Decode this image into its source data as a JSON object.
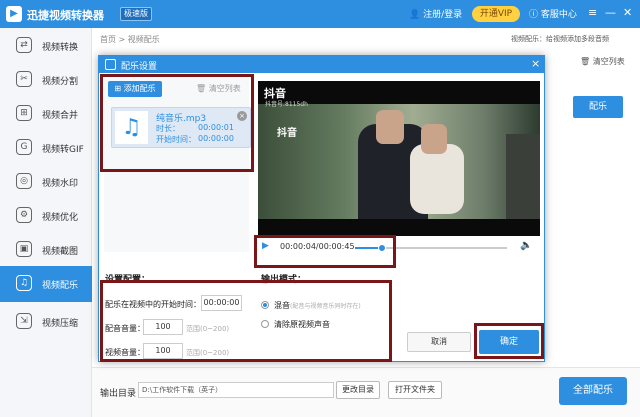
{
  "app": {
    "title": "迅捷视频转换器",
    "version": "极速版",
    "user": "注册/登录",
    "vip": "开通VIP",
    "service": "客服中心",
    "controls": {
      "menu": "≡",
      "minimize": "—",
      "close": "✕"
    }
  },
  "sidebar": {
    "items": [
      {
        "label": "视频转换",
        "icon": "⇄"
      },
      {
        "label": "视频分割",
        "icon": "✂"
      },
      {
        "label": "视频合并",
        "icon": "⊞"
      },
      {
        "label": "视频转GIF",
        "icon": "G"
      },
      {
        "label": "视频水印",
        "icon": "◎"
      },
      {
        "label": "视频优化",
        "icon": "⚙"
      },
      {
        "label": "视频截图",
        "icon": "▣"
      },
      {
        "label": "视频配乐",
        "icon": "♫",
        "active": true
      },
      {
        "label": "视频压缩",
        "icon": "⇲"
      }
    ]
  },
  "main": {
    "breadcrumb": "首页 > 视频配乐",
    "hint": "视频配乐：给视频添加多段音频",
    "clear_list": "清空列表",
    "pei_label": "配乐"
  },
  "output": {
    "label": "输出目录",
    "path": "D:\\工作软件下载（英子）",
    "change": "更改目录",
    "open": "打开文件夹",
    "all_label": "全部配乐"
  },
  "dialog": {
    "title": "配乐设置",
    "close": "×",
    "add_music": "添加配乐",
    "clear_list": "清空列表",
    "music": {
      "name": "纯音乐.mp3",
      "duration_label": "时长：",
      "duration": "00:00:01",
      "start_label": "开始时间：",
      "start": "00:00:00"
    },
    "video": {
      "wm1": "抖音",
      "wm2": "抖音号:8115dh",
      "wm3": "抖音"
    },
    "player": {
      "time": "00:00:04/00:00:45",
      "progress": 0.18
    },
    "settings": {
      "title": "设置配置：",
      "start_label": "配乐在视频中的开始时间：",
      "start_value": "00:00:00",
      "music_vol_label": "配音音量：",
      "music_vol": "100",
      "music_range": "范围(0~200)",
      "video_vol_label": "视频音量：",
      "video_vol": "100",
      "video_range": "范围(0~200)"
    },
    "mode": {
      "title": "输出模式：",
      "mix": "混音",
      "mix_note": "(配音与视频音乐同时存在)",
      "remove": "清除原视频声音"
    },
    "cancel": "取消",
    "confirm": "确定"
  }
}
